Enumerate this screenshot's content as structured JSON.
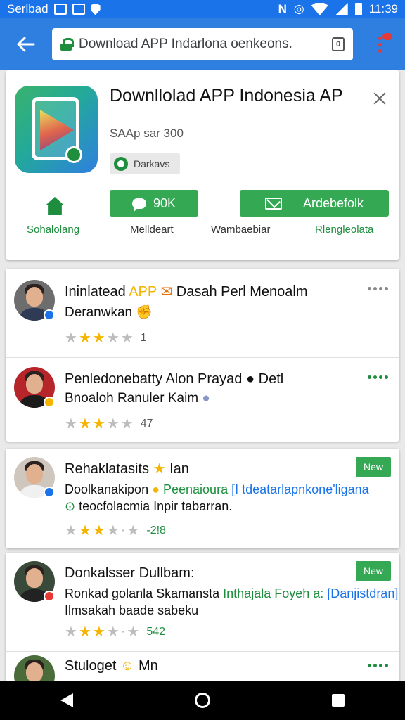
{
  "status_bar": {
    "carrier": "Serlbad",
    "time": "11:39"
  },
  "browser": {
    "url": "Download APP Indarlona oenkeons.",
    "tabs_count": "0"
  },
  "app": {
    "title": "Downllolad APP Indonesia AP",
    "subtitle": "SAAp sar 300",
    "chip_label": "Darkavs",
    "chat_button_label": "90K",
    "main_button_label": "Ardebefolk",
    "actions": [
      "Sohalolang",
      "Melldeart",
      "Wambaebiar",
      "Rlengleolata"
    ]
  },
  "reviews": [
    {
      "name": "Ininlatead",
      "name_highlight": "APP",
      "name_rest": "Dasah Perl Menoalm",
      "text": "Deranwkan",
      "stars": 3,
      "count": "1",
      "badge_color": "#1a73e8"
    },
    {
      "name": "Penledonebatty Alon Prayad",
      "name_rest": "Detl",
      "text": "Bnoaloh Ranuler Kaim",
      "stars": 3,
      "count": "47",
      "badge_color": "#f4b400"
    },
    {
      "name": "Rehaklatasits",
      "name_rest": "Ian",
      "text_a": "Doolkanakipon",
      "text_green": "Peenaioura",
      "text_blue": "[I tdeatarlapnkone'ligana",
      "text_b": "teocfolacmia Inpir tabarran.",
      "stars": 3,
      "count": "-2!8",
      "new_label": "New",
      "badge_color": "#1a73e8"
    },
    {
      "name": "Donkalsser Dullbam:",
      "text_a": "Ronkad golanla Skamansta",
      "text_green": "Inthajala Foyeh a:",
      "text_blue": "[Danjistdran]",
      "text_b": "Ilmsakah baade sabeku",
      "stars": 3,
      "count": "542",
      "new_label": "New",
      "badge_color": "#e53935"
    },
    {
      "name": "Stuloget",
      "name_rest": "Mn"
    }
  ]
}
